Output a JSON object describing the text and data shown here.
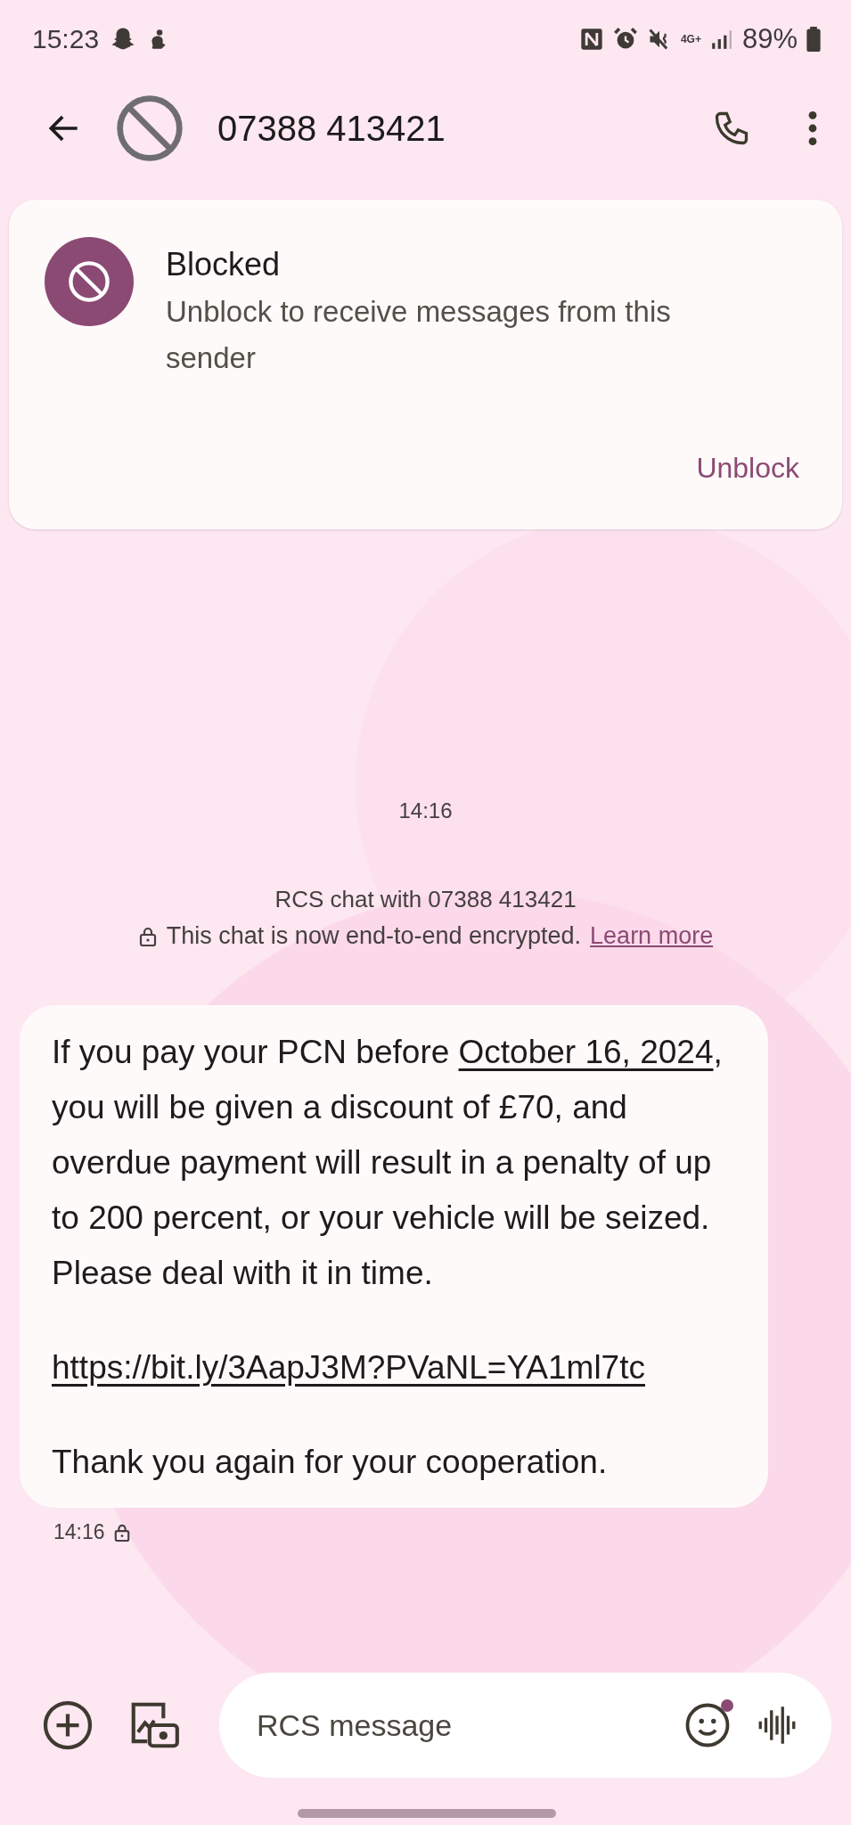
{
  "status_bar": {
    "time": "15:23",
    "network": "4G+",
    "battery": "89%"
  },
  "header": {
    "contact": "07388 413421"
  },
  "blocked_card": {
    "title": "Blocked",
    "description": "Unblock to receive messages from this sender",
    "action": "Unblock"
  },
  "conversation": {
    "timestamp": "14:16",
    "chat_info": "RCS chat with 07388 413421",
    "encryption_notice": "This chat is now end-to-end encrypted.",
    "learn_more": "Learn more",
    "messages": [
      {
        "paragraphs": [
          [
            {
              "kind": "text",
              "text": "If you pay your PCN before "
            },
            {
              "kind": "link",
              "text": "October 16, 2024"
            },
            {
              "kind": "text",
              "text": ", you will be given a discount of £70, and overdue payment will result in a penalty of up to 200 percent, or your vehicle will be seized. Please deal with it in time."
            }
          ],
          [
            {
              "kind": "link",
              "text": "https://bit.ly/3AapJ3M?PVaNL=YA1ml7tc"
            }
          ],
          [
            {
              "kind": "text",
              "text": "Thank you again for your cooperation."
            }
          ]
        ],
        "time": "14:16",
        "encrypted": true
      }
    ]
  },
  "composer": {
    "placeholder": "RCS message",
    "emoji_badge": true
  }
}
